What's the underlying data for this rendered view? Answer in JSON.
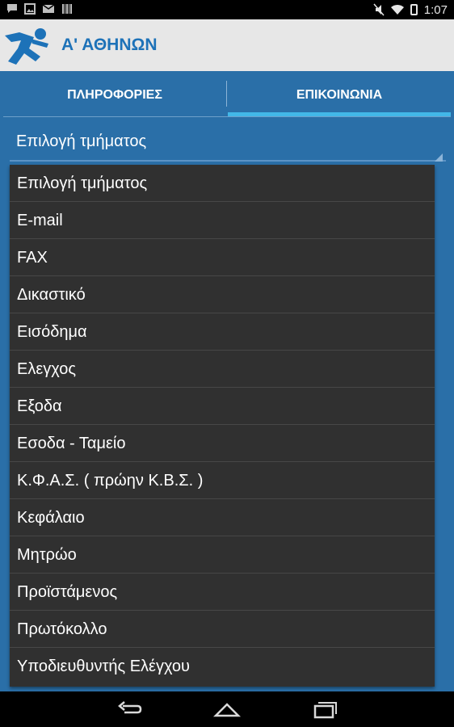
{
  "status_bar": {
    "time": "1:07",
    "left_icons": [
      "chat-icon",
      "image-icon",
      "mail-icon",
      "barcode-icon"
    ],
    "right_icons": [
      "mute-icon",
      "wifi-icon",
      "battery-icon"
    ]
  },
  "app": {
    "title": "Α' ΑΘΗΝΩΝ",
    "logo_icon": "running-figure-icon",
    "colors": {
      "title": "#1d72b8",
      "appbar_bg": "#e7e7e7",
      "accent": "#42b7e8",
      "content_bg": "#2a6fa8"
    }
  },
  "tabs": [
    {
      "label": "ΠΛΗΡΟΦΟΡΙΕΣ",
      "selected": false
    },
    {
      "label": "ΕΠΙΚΟΙΝΩΝΙΑ",
      "selected": true
    }
  ],
  "spinner": {
    "selected_value": "Επιλογή τμήματος"
  },
  "dropdown": {
    "options": [
      "Επιλογή τμήματος",
      "E-mail",
      "FAX",
      "Δικαστικό",
      "Εισόδημα",
      "Ελεγχος",
      "Εξοδα",
      "Εσοδα - Ταμείο",
      "Κ.Φ.Α.Σ. ( πρώην Κ.Β.Σ. )",
      "Κεφάλαιο",
      "Μητρώο",
      "Προϊστάμενος",
      "Πρωτόκολλο",
      "Υποδιευθυντής Ελέγχου"
    ]
  },
  "nav_bar": {
    "icons": [
      "back-icon",
      "home-icon",
      "recent-apps-icon"
    ]
  }
}
